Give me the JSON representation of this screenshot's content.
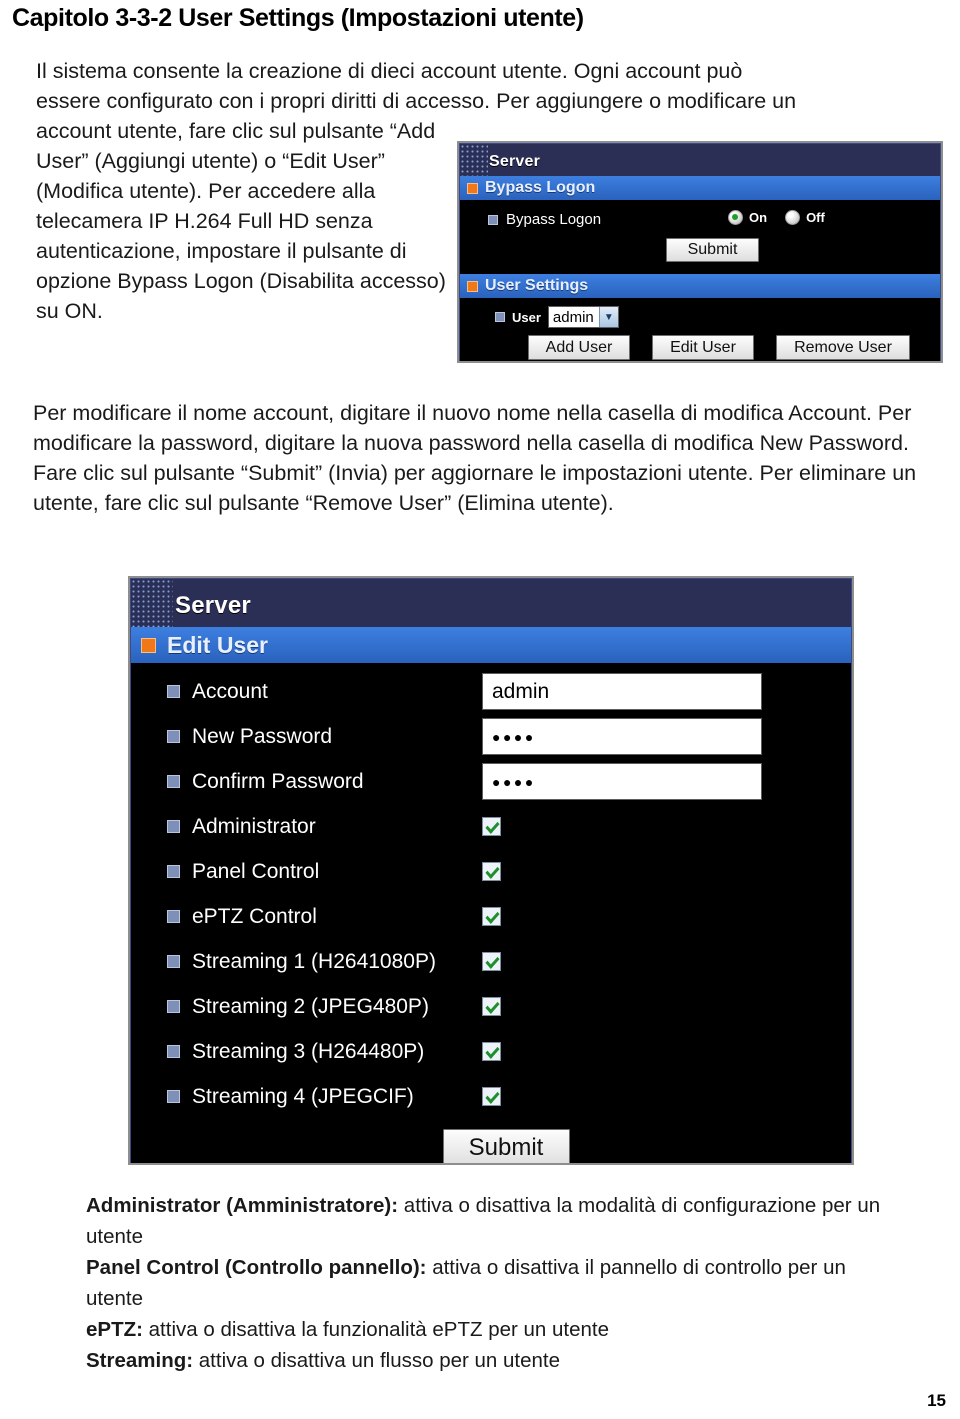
{
  "document": {
    "chapter_title": "Capitolo 3-3-2 User Settings (Impostazioni utente)",
    "page_number": "15"
  },
  "intro": {
    "line1": "Il sistema consente la creazione di dieci account utente. Ogni account può",
    "line2": "essere configurato con i propri diritti di accesso. Per aggiungere o modificare un",
    "wrapped": "account utente, fare clic sul pulsante “Add User” (Aggiungi utente) o “Edit User” (Modifica utente). Per accedere alla telecamera IP H.264 Full HD senza autenticazione, impostare il pulsante di opzione Bypass Logon (Disabilita accesso) su ON."
  },
  "middle_paragraph": {
    "text": "Per modificare il nome account, digitare il nuovo nome nella casella di modifica Account. Per modificare la password, digitare la nuova password nella casella di modifica New Password. Fare clic sul pulsante “Submit” (Invia) per aggiornare le impostazioni utente. Per eliminare un utente, fare clic sul pulsante “Remove User” (Elimina utente)."
  },
  "screenshot_bypass": {
    "window_title": "Server",
    "section_title": "Bypass Logon",
    "row_label": "Bypass Logon",
    "radio_on_label": "On",
    "radio_off_label": "Off",
    "radio_selected": "On",
    "submit_label": "Submit",
    "user_section_title": "User Settings",
    "user_row_label": "User",
    "user_selected": "admin",
    "buttons": [
      {
        "label": "Add User"
      },
      {
        "label": "Edit User"
      },
      {
        "label": "Remove User"
      }
    ],
    "colors": {
      "titlebar": "#2b2f55",
      "section_header": "#2f6fd0",
      "body": "#000000",
      "bullet_orange": "#f07818",
      "bullet_blue": "#7e90b8",
      "check_green": "#1e8f2c"
    }
  },
  "screenshot_edituser": {
    "window_title": "Server",
    "section_title": "Edit User",
    "fields": [
      {
        "label": "Account",
        "type": "text",
        "value": "admin"
      },
      {
        "label": "New Password",
        "type": "password",
        "value": "●●●●"
      },
      {
        "label": "Confirm Password",
        "type": "password",
        "value": "●●●●"
      },
      {
        "label": "Administrator",
        "type": "checkbox",
        "checked": true
      },
      {
        "label": "Panel Control",
        "type": "checkbox",
        "checked": true
      },
      {
        "label": "ePTZ Control",
        "type": "checkbox",
        "checked": true
      },
      {
        "label": "Streaming 1 (H2641080P)",
        "type": "checkbox",
        "checked": true
      },
      {
        "label": "Streaming 2 (JPEG480P)",
        "type": "checkbox",
        "checked": true
      },
      {
        "label": "Streaming 3 (H264480P)",
        "type": "checkbox",
        "checked": true
      },
      {
        "label": "Streaming 4 (JPEGCIF)",
        "type": "checkbox",
        "checked": true
      }
    ],
    "submit_label": "Submit"
  },
  "legend": [
    {
      "term": "Administrator (Amministratore):",
      "desc": " attiva o disattiva la modalità di configurazione per un utente"
    },
    {
      "term": "Panel Control (Controllo pannello):",
      "desc": " attiva o disattiva il pannello di controllo per un utente"
    },
    {
      "term": "ePTZ:",
      "desc": " attiva o disattiva la funzionalità ePTZ per un utente"
    },
    {
      "term": "Streaming:",
      "desc": " attiva o disattiva un flusso per un utente"
    }
  ]
}
